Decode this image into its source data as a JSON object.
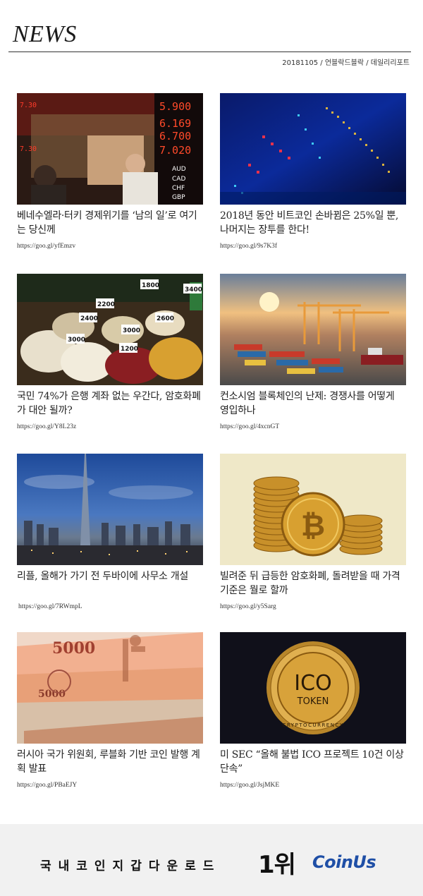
{
  "masthead": {
    "title": "NEWS",
    "meta": "20181105 / 언블락드블락 / 데일리리포트"
  },
  "articles": [
    {
      "headline": "베네수엘라·터키 경제위기를 ‘남의 일’로 여기는 당신께",
      "link": "https://goo.gl/yfEmzv",
      "image": "currency-exchange-board-photo"
    },
    {
      "headline": "2018년 동안 비트코인 손바뀜은 25%일 뿐, 나머지는 장투를 한다!",
      "link": "https://goo.gl/9s7K3f",
      "image": "stock-ticker-display-photo"
    },
    {
      "headline": "국민 74%가 은행 계좌 없는 우간다, 암호화폐가 대안 될까?",
      "link": "https://goo.gl/Y8L23z",
      "image": "market-grain-sacks-photo"
    },
    {
      "headline": "컨소시엄 블록체인의 난제: 경쟁사를 어떻게 영입하나",
      "link": "https://goo.gl/4xcnGT",
      "image": "container-port-photo"
    },
    {
      "headline": "리플, 올해가 가기 전 두바이에 사무소 개설",
      "link": "https://goo.gl/7RWmpL",
      "image": "dubai-skyline-photo"
    },
    {
      "headline": "빌려준 뒤 급등한 암호화폐, 돌려받을 때 가격기준은 뭘로 할까",
      "link": "https://goo.gl/y5Sarg",
      "image": "bitcoin-coin-stack-photo"
    },
    {
      "headline": "러시아 국가 위원회, 루블화 기반 코인 발행 계획 발표",
      "link": "https://goo.gl/PBaEJY",
      "image": "ruble-banknotes-photo"
    },
    {
      "headline": "미 SEC “올해 불법 ICO 프로젝트 10건 이상 단속”",
      "link": "https://goo.gl/JsjMKE",
      "image": "ico-token-coin-photo"
    }
  ],
  "image_text": {
    "exchange_rates": [
      "5.900",
      "6.169",
      "6.700",
      "7.020",
      "7.30"
    ],
    "currency_codes": [
      "AUD",
      "CAD",
      "CHF",
      "GBP"
    ],
    "grain_prices": [
      "1800",
      "3000",
      "2400",
      "2600",
      "3000",
      "3400",
      "1200",
      "2200"
    ],
    "ico_coin": {
      "line1": "ICO",
      "line2": "TOKEN",
      "ring": "CRYPTOCURRENCY"
    },
    "ruble_note": "5000"
  },
  "footer": {
    "slogan": "국내코인지갑다운로드",
    "rank": "1위",
    "logo": "CoinUs"
  },
  "colors": {
    "brand_blue": "#1f4fa6",
    "footer_bg": "#f1f1f1",
    "rule": "#333333"
  }
}
